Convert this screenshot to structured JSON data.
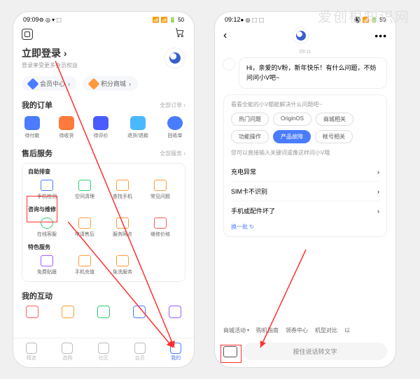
{
  "watermark": "爱创根知识网",
  "phone1": {
    "status_time": "09:09",
    "status_icons_left": "⚙ ◎ ▾ ⬚",
    "status_icons_right": "📶 📶 🔋 50",
    "login_title": "立即登录",
    "login_arrow": "›",
    "login_sub": "登录享受更多会员权益",
    "pills": [
      "会员中心",
      "积分商城"
    ],
    "pill_arrow": "›",
    "orders": {
      "title": "我的订单",
      "link": "全部订单 ›",
      "items": [
        "待付款",
        "待收货",
        "待评价",
        "退货/退款",
        "回收单"
      ]
    },
    "aftersales": {
      "title": "售后服务",
      "link": "全部服务 ›",
      "group1_title": "自助排查",
      "group1": [
        "手机检测",
        "空间清理",
        "查找手机",
        "常见问题"
      ],
      "group2_title": "咨询与维修",
      "group2": [
        "在线客服",
        "申请售后",
        "服务网点",
        "维修价格"
      ],
      "group3_title": "特色服务",
      "group3": [
        "免费贴膜",
        "手机充值",
        "免洗服务"
      ]
    },
    "interaction": {
      "title": "我的互动"
    },
    "tabs": [
      "精选",
      "选购",
      "社区",
      "会员",
      "我的"
    ]
  },
  "phone2": {
    "status_time": "09:12",
    "status_icons_left": "● ◎ ⬚ ⬚",
    "status_icons_right": "⚫ 📶 🔋 50",
    "chat_time": "09:11",
    "bubble": "Hi，亲爱的V粉，新年快乐！有什么问题，不妨问问小V吧~",
    "card_title": "看看全能的小V都能解决什么问题吧~",
    "chips": [
      "热门问题",
      "OriginOS",
      "商城相关",
      "功能操作",
      "产品故障",
      "帐号相关"
    ],
    "active_chip_index": 4,
    "q_hint": "您可以直接输入关键词或像这样问小V哦",
    "questions": [
      "充电异常",
      "SIM卡不识别",
      "手机或配件坏了"
    ],
    "refresh": "换一批 ↻",
    "bottom_chips": [
      "商城活动",
      "购机指南",
      "领券中心",
      "机型对比",
      "以"
    ],
    "voice_input": "按住说话转文字",
    "dots": "•••"
  }
}
